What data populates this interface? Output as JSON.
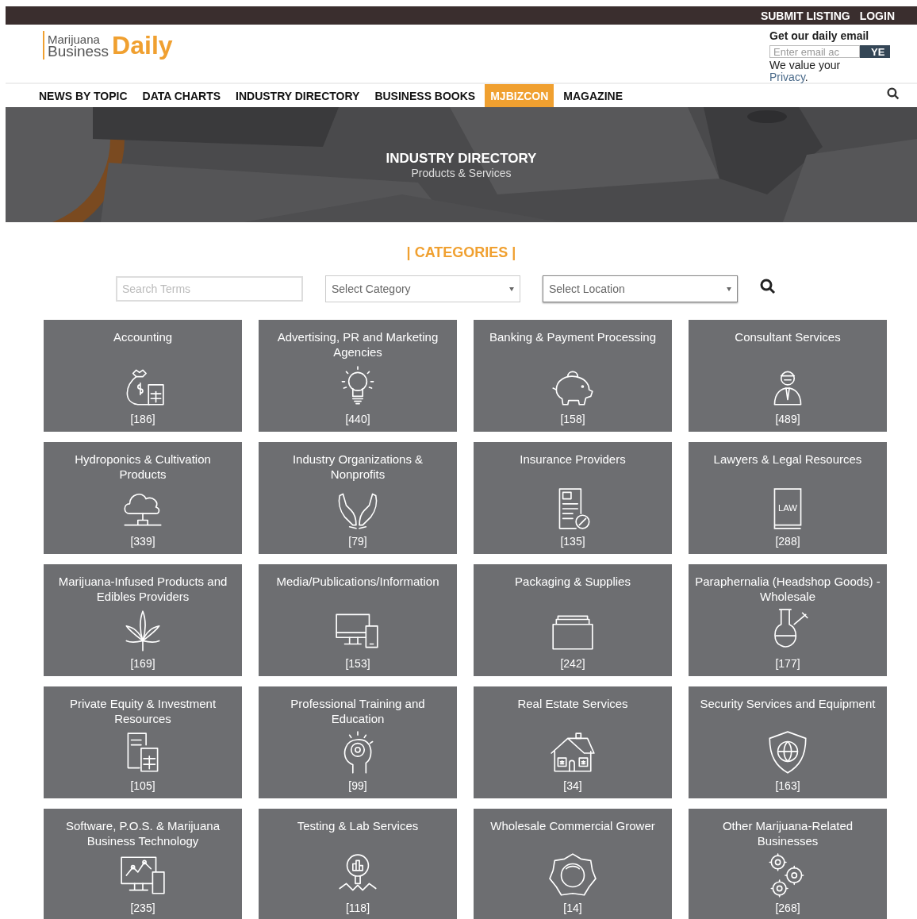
{
  "top_bar": {
    "links": [
      "SUBMIT LISTING",
      "LOGIN"
    ]
  },
  "logo": {
    "line_1": "Marijuana",
    "line_2": "Business",
    "brand": "Daily"
  },
  "newsletter": {
    "title": "Get our daily email",
    "placeholder": "Enter email ac",
    "button": "YE",
    "note": "We value your",
    "link": "Privacy",
    "note_end": "."
  },
  "nav": [
    {
      "label": "NEWS BY TOPIC",
      "selected": false
    },
    {
      "label": "DATA CHARTS",
      "selected": false
    },
    {
      "label": "INDUSTRY DIRECTORY",
      "selected": false
    },
    {
      "label": "BUSINESS BOOKS",
      "selected": false
    },
    {
      "label": "MJBIZCON",
      "selected": true
    },
    {
      "label": "MAGAZINE",
      "selected": false
    }
  ],
  "hero": {
    "title": "INDUSTRY DIRECTORY",
    "subtitle": "Products & Services"
  },
  "section_title": "| CATEGORIES |",
  "filters": {
    "search": {
      "placeholder": "Search Terms"
    },
    "category": {
      "value": "Select Category"
    },
    "location": {
      "value": "Select Location"
    }
  },
  "categories": [
    {
      "title": "Accounting",
      "count": "[186]"
    },
    {
      "title": "Advertising, PR and Marketing Agencies",
      "count": "[440]"
    },
    {
      "title": "Banking & Payment Processing",
      "count": "[158]"
    },
    {
      "title": "Consultant Services",
      "count": "[489]"
    },
    {
      "title": "Hydroponics & Cultivation Products",
      "count": "[339]"
    },
    {
      "title": "Industry Organizations & Nonprofits",
      "count": "[79]"
    },
    {
      "title": "Insurance Providers",
      "count": "[135]"
    },
    {
      "title": "Lawyers & Legal Resources",
      "count": "[288]",
      "icon_text": "LAW"
    },
    {
      "title": "Marijuana-Infused Products and Edibles Providers",
      "count": "[169]"
    },
    {
      "title": "Media/Publications/Information",
      "count": "[153]"
    },
    {
      "title": "Packaging & Supplies",
      "count": "[242]"
    },
    {
      "title": "Paraphernalia (Headshop Goods) - Wholesale",
      "count": "[177]"
    },
    {
      "title": "Private Equity & Investment Resources",
      "count": "[105]"
    },
    {
      "title": "Professional Training and Education",
      "count": "[99]"
    },
    {
      "title": "Real Estate Services",
      "count": "[34]"
    },
    {
      "title": "Security Services and Equipment",
      "count": "[163]"
    },
    {
      "title": "Software, P.O.S. & Marijuana Business Technology",
      "count": "[235]"
    },
    {
      "title": "Testing & Lab Services",
      "count": "[118]"
    },
    {
      "title": "Wholesale Commercial Grower",
      "count": "[14]"
    },
    {
      "title": "Other Marijuana-Related Businesses",
      "count": "[268]"
    }
  ]
}
